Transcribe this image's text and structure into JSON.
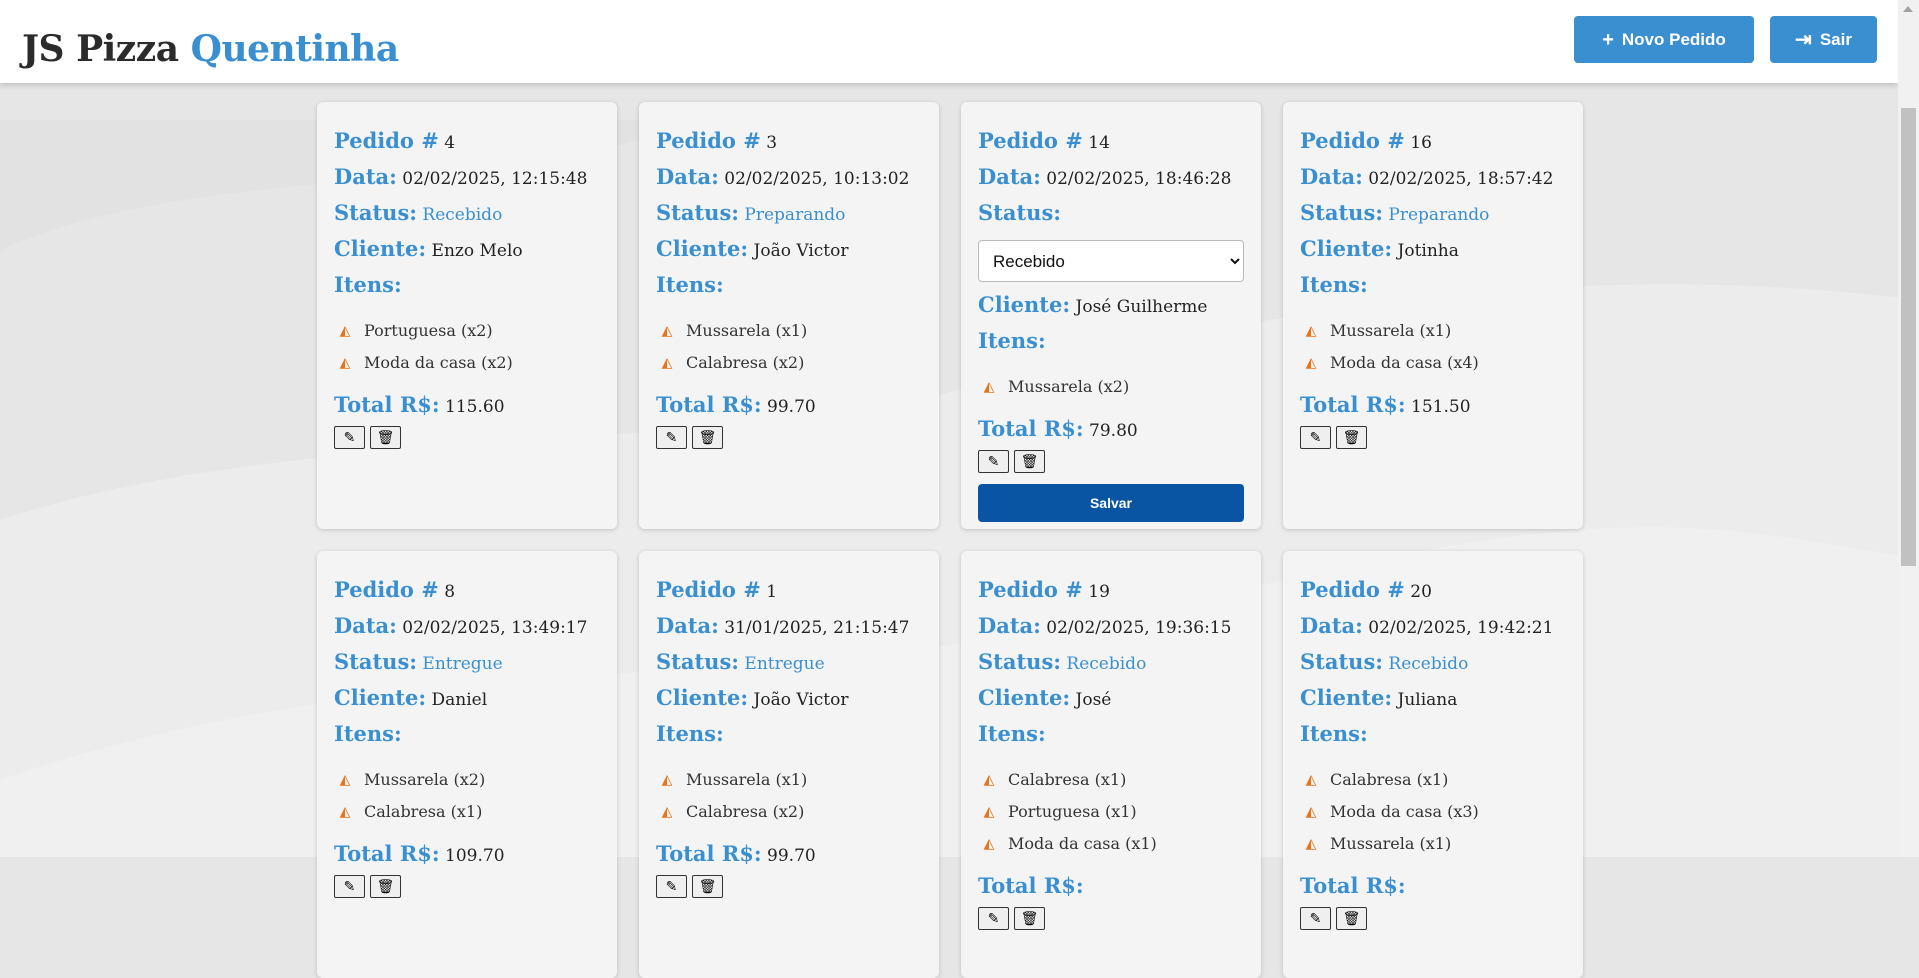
{
  "header": {
    "brand_main": "JS Pizza",
    "brand_accent": "Quentinha",
    "new_order_label": "Novo Pedido",
    "logout_label": "Sair",
    "accent_color": "#3a8fd0"
  },
  "labels": {
    "pedido": "Pedido #",
    "data": "Data:",
    "status": "Status:",
    "cliente": "Cliente:",
    "itens": "Itens:",
    "total": "Total R$:",
    "save": "Salvar"
  },
  "icons": {
    "new_order": "plus-icon",
    "logout": "sign-out-icon",
    "item": "pizza-slice-icon",
    "edit": "edit-icon",
    "delete": "trash-icon"
  },
  "status_options": [
    "Recebido",
    "Preparando",
    "Entregue"
  ],
  "orders": [
    {
      "id": "4",
      "date": "02/02/2025, 12:15:48",
      "status": "Recebido",
      "client": "Enzo Melo",
      "items": [
        "Portuguesa (x2)",
        "Moda da casa (x2)"
      ],
      "total": "115.60",
      "editing": false
    },
    {
      "id": "3",
      "date": "02/02/2025, 10:13:02",
      "status": "Preparando",
      "client": "João Victor",
      "items": [
        "Mussarela (x1)",
        "Calabresa (x2)"
      ],
      "total": "99.70",
      "editing": false
    },
    {
      "id": "14",
      "date": "02/02/2025, 18:46:28",
      "status": "Recebido",
      "client": "José Guilherme",
      "items": [
        "Mussarela (x2)"
      ],
      "total": "79.80",
      "editing": true
    },
    {
      "id": "16",
      "date": "02/02/2025, 18:57:42",
      "status": "Preparando",
      "client": "Jotinha",
      "items": [
        "Mussarela (x1)",
        "Moda da casa (x4)"
      ],
      "total": "151.50",
      "editing": false
    },
    {
      "id": "8",
      "date": "02/02/2025, 13:49:17",
      "status": "Entregue",
      "client": "Daniel",
      "items": [
        "Mussarela (x2)",
        "Calabresa (x1)"
      ],
      "total": "109.70",
      "editing": false
    },
    {
      "id": "1",
      "date": "31/01/2025, 21:15:47",
      "status": "Entregue",
      "client": "João Victor",
      "items": [
        "Mussarela (x1)",
        "Calabresa (x2)"
      ],
      "total": "99.70",
      "editing": false
    },
    {
      "id": "19",
      "date": "02/02/2025, 19:36:15",
      "status": "Recebido",
      "client": "José",
      "items": [
        "Calabresa (x1)",
        "Portuguesa (x1)",
        "Moda da casa (x1)"
      ],
      "total": "",
      "editing": false
    },
    {
      "id": "20",
      "date": "02/02/2025, 19:42:21",
      "status": "Recebido",
      "client": "Juliana",
      "items": [
        "Calabresa (x1)",
        "Moda da casa (x3)",
        "Mussarela (x1)"
      ],
      "total": "",
      "editing": false
    }
  ]
}
